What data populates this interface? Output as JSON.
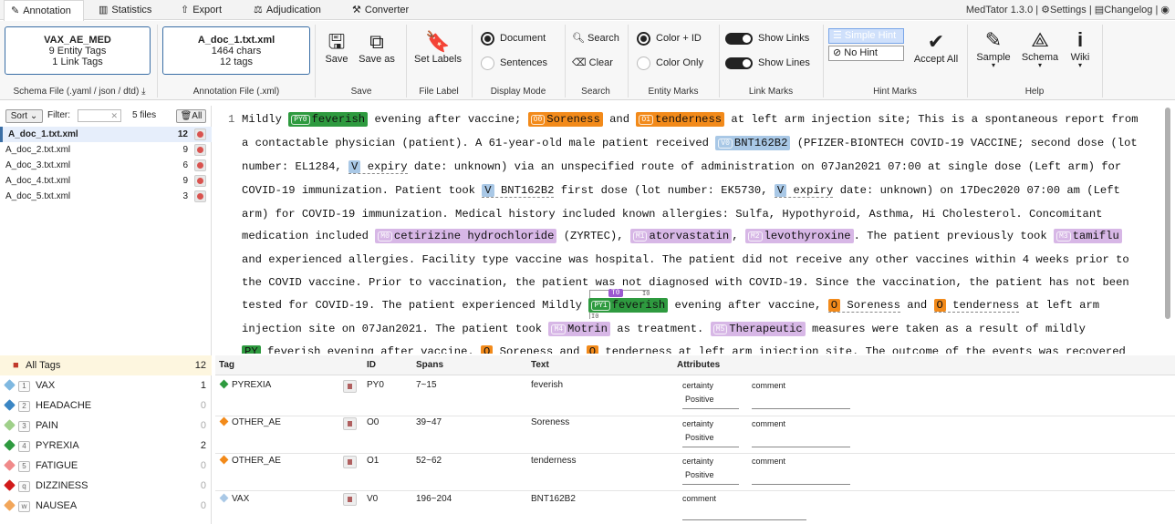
{
  "tabs": [
    {
      "label": "Annotation",
      "icon": "✎"
    },
    {
      "label": "Statistics",
      "icon": "▥"
    },
    {
      "label": "Export",
      "icon": "⇧"
    },
    {
      "label": "Adjudication",
      "icon": "⚖"
    },
    {
      "label": "Converter",
      "icon": "⚒"
    }
  ],
  "header_links": {
    "version": "MedTator 1.3.0",
    "settings": "Settings",
    "changelog": "Changelog"
  },
  "schema_box": {
    "name": "VAX_AE_MED",
    "entity": "9 Entity Tags",
    "link": "1 Link Tags",
    "label": "Schema File (.yaml / json / dtd)"
  },
  "ann_box": {
    "name": "A_doc_1.txt.xml",
    "chars": "1464 chars",
    "tags": "12 tags",
    "label": "Annotation File (.xml)"
  },
  "ribbon": {
    "save": "Save",
    "save_as": "Save as",
    "save_group": "Save",
    "set_labels": "Set Labels",
    "file_label_group": "File Label",
    "document": "Document",
    "sentences": "Sentences",
    "display_group": "Display Mode",
    "search": "Search",
    "clear": "Clear",
    "search_group": "Search",
    "color_id": "Color + ID",
    "color_only": "Color Only",
    "entity_group": "Entity Marks",
    "show_links": "Show Links",
    "show_lines": "Show Lines",
    "link_group": "Link Marks",
    "simple_hint": "Simple Hint",
    "no_hint": "No Hint",
    "accept_all": "Accept All",
    "hint_group": "Hint Marks",
    "sample": "Sample",
    "schema": "Schema",
    "wiki": "Wiki",
    "help_group": "Help"
  },
  "filter": {
    "sort": "Sort",
    "label": "Filter:",
    "count": "5 files",
    "all": "All"
  },
  "files": [
    {
      "name": "A_doc_1.txt.xml",
      "count": "12"
    },
    {
      "name": "A_doc_2.txt.xml",
      "count": "9"
    },
    {
      "name": "A_doc_3.txt.xml",
      "count": "6"
    },
    {
      "name": "A_doc_4.txt.xml",
      "count": "9"
    },
    {
      "name": "A_doc_5.txt.xml",
      "count": "3"
    }
  ],
  "editor": {
    "line_no": "1",
    "l1": [
      "Mildly ",
      "PY0",
      "feverish",
      " evening after vaccine; ",
      "O0",
      "Soreness",
      " and ",
      "O1",
      "tenderness",
      " at left arm injection site; This is a spontaneous report from"
    ],
    "l2": [
      "a contactable physician (patient). A 61-year-old male patient received ",
      "V0",
      "BNT162B2",
      " (PFIZER-BIONTECH COVID-19 VACCINE; second dose (lot"
    ],
    "l3": [
      "number: EL1284, ",
      "V",
      "expiry",
      " date: unknown) via an unspecified route of administration on 07Jan2021 07:00 at single dose (Left arm) for"
    ],
    "l4": [
      "COVID-19 immunization. Patient took ",
      "V",
      "BNT162B2",
      " first dose (lot number: EK5730, ",
      "V",
      "expiry",
      " date: unknown) on 17Dec2020  07:00 am (Left"
    ],
    "l5": "arm) for COVID-19 immunization. Medical history included known allergies: Sulfa, Hypothyroid, Asthma, Hi Cholesterol.  Concomitant",
    "l6": [
      "medication included ",
      "M0",
      "cetirizine hydrochloride",
      " (ZYRTEC), ",
      "M1",
      "atorvastatin",
      ", ",
      "M2",
      "levothyroxine",
      ". The patient previously took ",
      "M3",
      "tamiflu"
    ],
    "l7": "and experienced allergies.  Facility type vaccine was hospital. The patient did not receive any other vaccines within 4 weeks prior to",
    "l8": "the COVID vaccine. Prior to vaccination, the patient was not diagnosed with COVID-19. Since the vaccination, the patient has not been",
    "l9": [
      "tested for COVID-19. The patient experienced Mildly ",
      "PY1",
      "feverish",
      " evening after vaccine, ",
      "O",
      "Soreness",
      " and ",
      "O",
      "tenderness",
      " at left arm"
    ],
    "l10": [
      "injection site on 07Jan2021. The patient took ",
      "M4",
      "Motrin",
      " as treatment. ",
      "M5",
      "Therapeutic",
      " measures were taken as a result of mildly"
    ],
    "l11": [
      "PY",
      "feverish evening after vaccine. ",
      "O",
      "Soreness and ",
      "O",
      "tenderness at left arm injection site. The outcome of the events was recovered"
    ],
    "link_id": "T0",
    "link_l": "I0",
    "link_r": "I0"
  },
  "tag_list": {
    "header": {
      "name": "All Tags",
      "count": "12"
    },
    "items": [
      {
        "key": "1",
        "name": "VAX",
        "count": "1",
        "color": "#7fb8e0"
      },
      {
        "key": "2",
        "name": "HEADACHE",
        "count": "0",
        "color": "#3a86c4"
      },
      {
        "key": "3",
        "name": "PAIN",
        "count": "0",
        "color": "#9fd08a"
      },
      {
        "key": "4",
        "name": "PYREXIA",
        "count": "2",
        "color": "#2e9a3f"
      },
      {
        "key": "5",
        "name": "FATIGUE",
        "count": "0",
        "color": "#f08a8a"
      },
      {
        "key": "q",
        "name": "DIZZINESS",
        "count": "0",
        "color": "#d11a1a"
      },
      {
        "key": "w",
        "name": "NAUSEA",
        "count": "0",
        "color": "#f2a65a"
      }
    ]
  },
  "table": {
    "headers": {
      "tag": "Tag",
      "id": "ID",
      "spans": "Spans",
      "text": "Text",
      "attrs": "Attributes"
    },
    "rows": [
      {
        "tag": "PYREXIA",
        "id": "PY0",
        "spans": "7~15",
        "text": "feverish",
        "a1": "certainty",
        "v1": "Positive",
        "a2": "comment",
        "color": "#2e9a3f"
      },
      {
        "tag": "OTHER_AE",
        "id": "O0",
        "spans": "39~47",
        "text": "Soreness",
        "a1": "certainty",
        "v1": "Positive",
        "a2": "comment",
        "color": "#f28a1a"
      },
      {
        "tag": "OTHER_AE",
        "id": "O1",
        "spans": "52~62",
        "text": "tenderness",
        "a1": "certainty",
        "v1": "Positive",
        "a2": "comment",
        "color": "#f28a1a"
      },
      {
        "tag": "VAX",
        "id": "V0",
        "spans": "196~204",
        "text": "BNT162B2",
        "a1": "comment",
        "v1": "",
        "a2": "",
        "color": "#a9c8e6"
      }
    ]
  }
}
